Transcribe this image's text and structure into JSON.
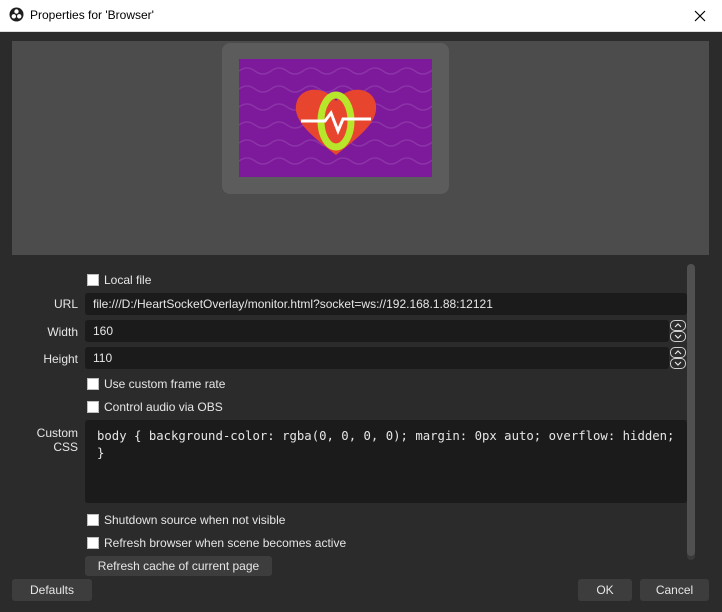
{
  "window": {
    "title": "Properties for 'Browser'",
    "app_icon": "obs-logo-icon",
    "close_icon": "close-icon"
  },
  "preview": {
    "content_icon": "heart-monitor-icon",
    "colors": {
      "canvas": "#7d1a9c",
      "heart": "#e8452e",
      "ring": "#b7e62a"
    }
  },
  "form": {
    "local_file": {
      "label": "Local file",
      "checked": false
    },
    "url": {
      "label": "URL",
      "value": "file:///D:/HeartSocketOverlay/monitor.html?socket=ws://192.168.1.88:12121"
    },
    "width": {
      "label": "Width",
      "value": "160"
    },
    "height": {
      "label": "Height",
      "value": "110"
    },
    "custom_frame_rate": {
      "label": "Use custom frame rate",
      "checked": false
    },
    "control_audio": {
      "label": "Control audio via OBS",
      "checked": false
    },
    "custom_css": {
      "label": "Custom CSS",
      "value": "body { background-color: rgba(0, 0, 0, 0); margin: 0px auto; overflow: hidden; }"
    },
    "shutdown_source": {
      "label": "Shutdown source when not visible",
      "checked": false
    },
    "refresh_browser": {
      "label": "Refresh browser when scene becomes active",
      "checked": false
    },
    "refresh_cache_button": "Refresh cache of current page"
  },
  "footer": {
    "defaults_button": "Defaults",
    "ok_button": "OK",
    "cancel_button": "Cancel"
  }
}
